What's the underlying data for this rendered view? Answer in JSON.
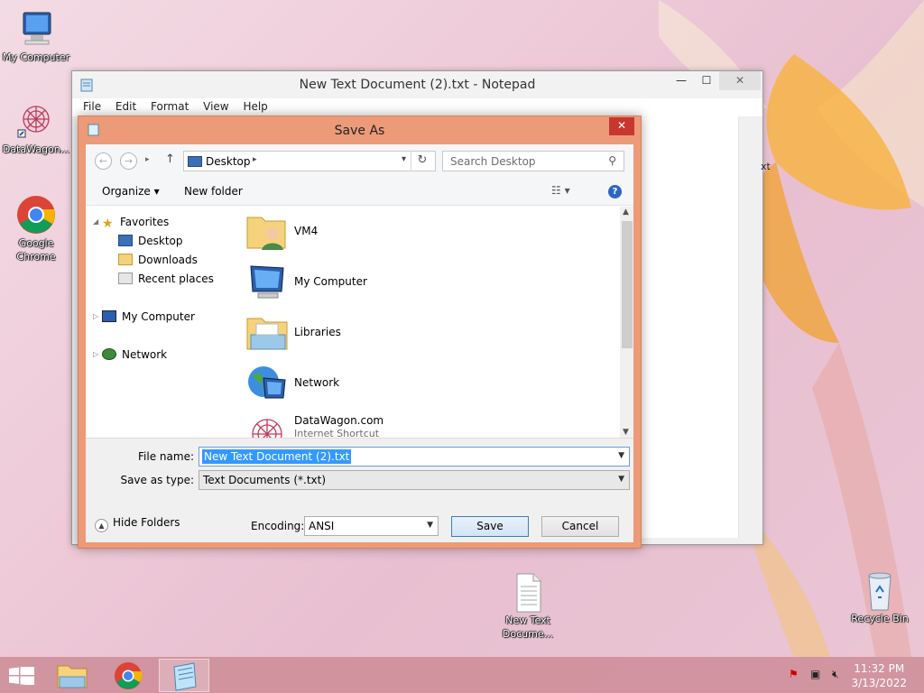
{
  "desktop": {
    "icons": [
      {
        "label": "My Computer"
      },
      {
        "label": "DataWagon..."
      },
      {
        "label": "Google Chrome"
      },
      {
        "label": "New Text Docume..."
      },
      {
        "label": "Recycle Bin"
      }
    ]
  },
  "notepad": {
    "title": "New Text Document (2).txt - Notepad",
    "menu": [
      "File",
      "Edit",
      "Format",
      "View",
      "Help"
    ],
    "controls": {
      "minimize": "—",
      "maximize": "☐",
      "close": "✕"
    },
    "peek_text": "xt"
  },
  "dialog": {
    "title": "Save As",
    "close": "✕",
    "address": "Desktop",
    "search_placeholder": "Search Desktop",
    "toolbar": {
      "organize": "Organize ▾",
      "new_folder": "New folder",
      "help": "?"
    },
    "nav": {
      "favorites": "Favorites",
      "desktop": "Desktop",
      "downloads": "Downloads",
      "recent": "Recent places",
      "my_computer": "My Computer",
      "network": "Network"
    },
    "files": [
      {
        "name": "VM4",
        "sub": ""
      },
      {
        "name": "My Computer",
        "sub": ""
      },
      {
        "name": "Libraries",
        "sub": ""
      },
      {
        "name": "Network",
        "sub": ""
      },
      {
        "name": "DataWagon.com",
        "sub": "Internet Shortcut"
      }
    ],
    "file_name_label": "File name:",
    "file_name_value": "New Text Document (2).txt",
    "save_type_label": "Save as type:",
    "save_type_value": "Text Documents (*.txt)",
    "hide_folders": "Hide Folders",
    "encoding_label": "Encoding:",
    "encoding_value": "ANSI",
    "save": "Save",
    "cancel": "Cancel"
  },
  "taskbar": {
    "time": "11:32 PM",
    "date": "3/13/2022"
  }
}
